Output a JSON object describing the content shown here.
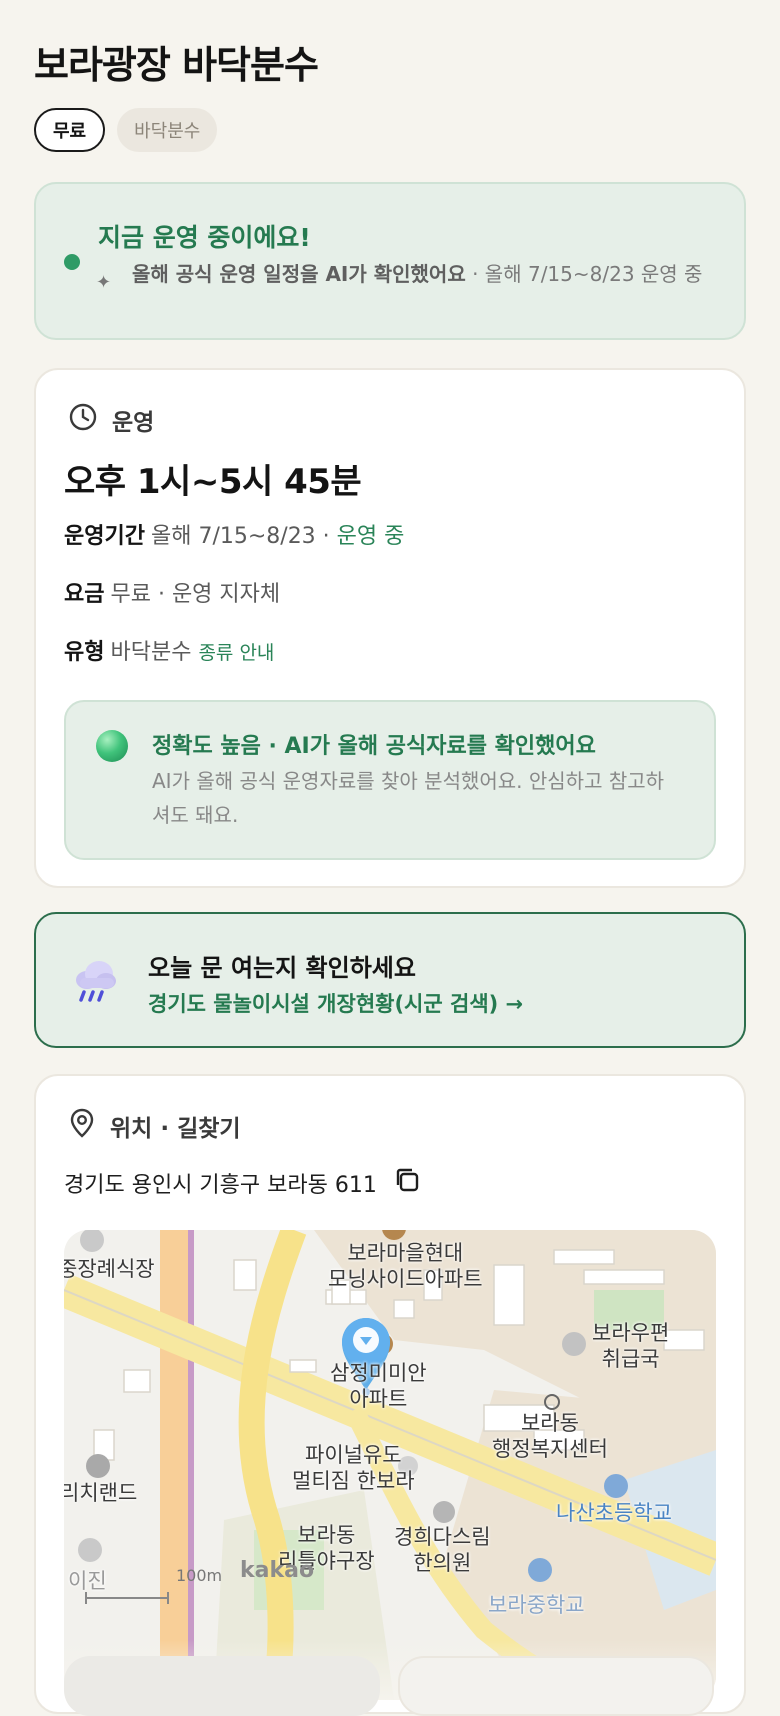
{
  "title": "보라광장 바닥분수",
  "chips": {
    "free": "무료",
    "type": "바닥분수"
  },
  "status": {
    "headline": "지금 운영 중이에요!",
    "note_bold": "올해 공식 운영 일정을 AI가 확인했어요",
    "note_rest": " · 올해 7/15~8/23 운영 중",
    "accent_color": "#2f9b66"
  },
  "operation": {
    "section_title": "운영",
    "hours": "오후 1시~5시 45분",
    "period_label": "운영기간",
    "period_value": "올해 7/15~8/23 · ",
    "period_status": "운영 중",
    "fee_label": "요금",
    "fee_value": "무료 · 운영 지자체",
    "type_label": "유형",
    "type_value": "바닥분수",
    "type_link": "종류 안내",
    "accuracy_title": "정확도 높음 · AI가 올해 공식자료를 확인했어요",
    "accuracy_desc": "AI가 올해 공식 운영자료를 찾아 분석했어요. 안심하고 참고하셔도 돼요."
  },
  "check": {
    "title": "오늘 문 여는지 확인하세요",
    "link": "경기도 물놀이시설 개장현황(시군 검색) →",
    "icon": "rain-cloud-icon"
  },
  "location": {
    "section_title": "위치 · 길찾기",
    "address": "경기도 용인시 기흥구 보라동 611",
    "copy_icon": "copy-icon",
    "map": {
      "labels": {
        "l1": "보라마을현대\n모닝사이드아파트",
        "l2": "보라우편\n취급국",
        "l3": "삼정미미안\n아파트",
        "l4": "보라동\n행정복지센터",
        "l5": "파이널유도\n멀티짐 한보라",
        "l6": "나산초등학교",
        "l7": "보라동\n리틀야구장",
        "l8": "경희다스림\n한의원",
        "l9": "중장례식장",
        "l10": "리치랜드",
        "l11": "이진",
        "l12": "보라중학교"
      },
      "scale": "100m",
      "brand": "kakao"
    }
  }
}
